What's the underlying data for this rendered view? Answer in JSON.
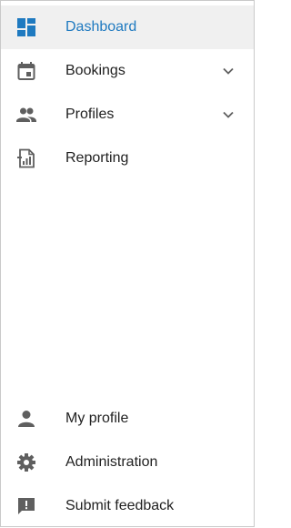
{
  "nav": {
    "dashboard": {
      "label": "Dashboard",
      "active": true
    },
    "bookings": {
      "label": "Bookings"
    },
    "profiles": {
      "label": "Profiles"
    },
    "reporting": {
      "label": "Reporting"
    }
  },
  "footer_nav": {
    "my_profile": {
      "label": "My profile"
    },
    "administration": {
      "label": "Administration"
    },
    "submit_feedback": {
      "label": "Submit feedback"
    }
  },
  "colors": {
    "accent": "#1f7ac0",
    "icon": "#5f5f5f",
    "text": "#212121",
    "active_background": "#f0f0f0",
    "border": "#c9c9c9"
  },
  "icons": {
    "dashboard": "dashboard-icon",
    "bookings": "calendar-icon",
    "profiles": "people-icon",
    "reporting": "report-icon",
    "my_profile": "person-icon",
    "administration": "gear-icon",
    "submit_feedback": "feedback-icon",
    "expand": "chevron-down-icon"
  }
}
